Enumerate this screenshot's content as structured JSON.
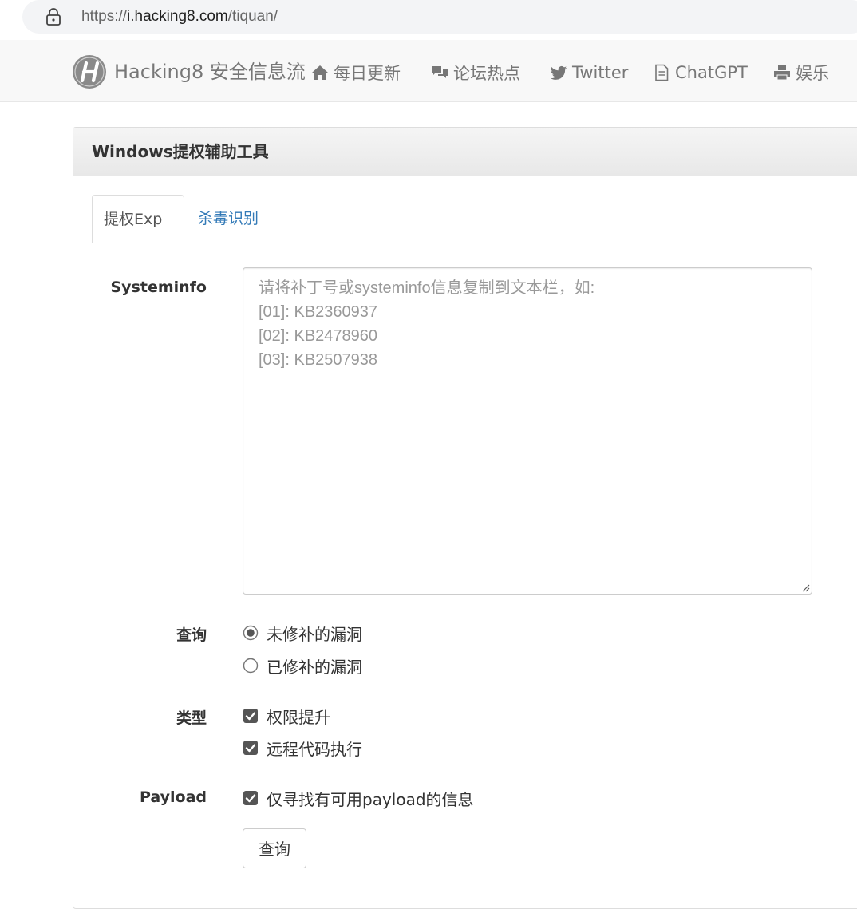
{
  "browser": {
    "url_scheme": "https://",
    "url_host": "i.hacking8.com",
    "url_path": "/tiquan/"
  },
  "navbar": {
    "brand": "Hacking8 安全信息流",
    "items": [
      {
        "label": "每日更新",
        "icon": "home-icon"
      },
      {
        "label": "论坛热点",
        "icon": "comments-icon"
      },
      {
        "label": "Twitter",
        "icon": "twitter-icon"
      },
      {
        "label": "ChatGPT",
        "icon": "document-icon"
      },
      {
        "label": "娱乐",
        "icon": "printer-icon"
      }
    ]
  },
  "panel": {
    "title": "Windows提权辅助工具",
    "tabs": [
      {
        "label": "提权Exp",
        "active": true
      },
      {
        "label": "杀毒识别",
        "active": false
      }
    ]
  },
  "form": {
    "systeminfo_label": "Systeminfo",
    "systeminfo_value": "",
    "systeminfo_placeholder_lines": [
      "请将补丁号或systeminfo信息复制到文本栏，如:",
      "[01]: KB2360937",
      "[02]: KB2478960",
      "[03]: KB2507938"
    ],
    "query_label": "查询",
    "query_options": [
      {
        "label": "未修补的漏洞",
        "selected": true
      },
      {
        "label": "已修补的漏洞",
        "selected": false
      }
    ],
    "type_label": "类型",
    "type_options": [
      {
        "label": "权限提升",
        "checked": true
      },
      {
        "label": "远程代码执行",
        "checked": true
      }
    ],
    "payload_label": "Payload",
    "payload_option": {
      "label": "仅寻找有可用payload的信息",
      "checked": true
    },
    "submit_label": "查询"
  },
  "colors": {
    "link": "#337ab7",
    "nav_text": "#777777",
    "placeholder": "#999999",
    "checkbox_fill": "#555555"
  }
}
